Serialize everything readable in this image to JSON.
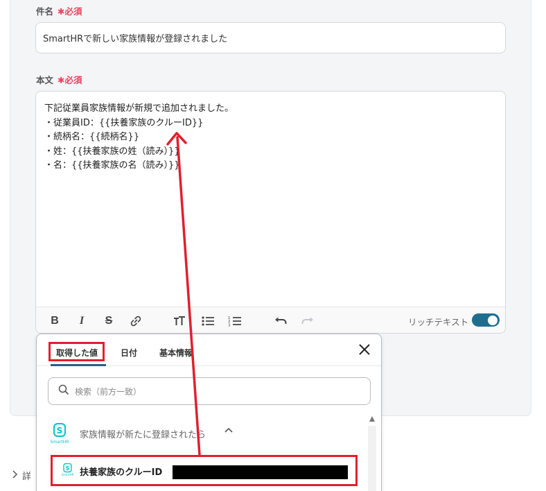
{
  "subject": {
    "label": "件名",
    "required": "✱必須",
    "value": "SmartHRで新しい家族情報が登録されました"
  },
  "body": {
    "label": "本文",
    "required": "✱必須",
    "lines": [
      "下記従業員家族情報が新規で追加されました。",
      "・従業員ID：{{扶養家族のクルーID}}",
      "・続柄名：{{続柄名}}",
      "・姓：{{扶養家族の姓（読み）}}",
      "・名：{{扶養家族の名（読み）}}"
    ]
  },
  "toolbar": {
    "bold": "B",
    "italic": "I",
    "strike": "S",
    "rich_text_label": "リッチテキスト",
    "rich_text_enabled": true
  },
  "popup": {
    "tabs": [
      "取得した値",
      "日付",
      "基本情報"
    ],
    "active_tab": "取得した値",
    "search_placeholder": "検索（前方一致）",
    "group_title": "家族情報が新たに登録されたら",
    "logo_text": "SmartHR",
    "item_label": "扶養家族のクルーID"
  },
  "details_label": "詳",
  "colors": {
    "accent": "#1e6e8f",
    "required": "#e94560",
    "highlight": "#e11f2e",
    "smarthr": "#00c4cc"
  }
}
